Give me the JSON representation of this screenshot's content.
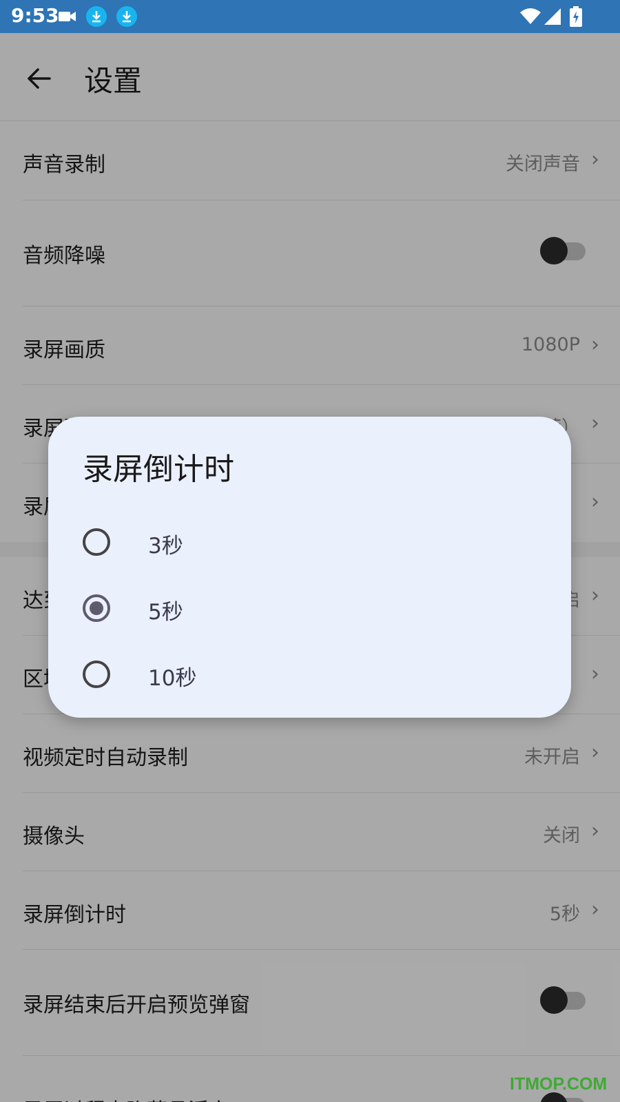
{
  "status_bar": {
    "time": "9:53",
    "icons": [
      "video-camera-icon",
      "download-icon",
      "download-icon",
      "wifi-icon",
      "signal-icon",
      "battery-charging-icon"
    ]
  },
  "header": {
    "title": "设置"
  },
  "settings": [
    {
      "label": "声音录制",
      "value": "关闭声音",
      "type": "chevron"
    },
    {
      "label": "音频降噪",
      "type": "toggle",
      "on": false
    },
    {
      "label": "录屏画质",
      "value": "1080P",
      "type": "chevron"
    },
    {
      "label": "录屏预...",
      "value": "...（推荐）",
      "type": "chevron"
    },
    {
      "label": "录屏...",
      "value": "",
      "type": "chevron"
    },
    {
      "label": "达到...",
      "value": "...启",
      "type": "chevron"
    },
    {
      "label": "区域...",
      "value": "",
      "type": "chevron"
    },
    {
      "label": "视频定时自动录制",
      "value": "未开启",
      "type": "chevron"
    },
    {
      "label": "摄像头",
      "value": "关闭",
      "type": "chevron"
    },
    {
      "label": "录屏倒计时",
      "value": "5秒",
      "type": "chevron"
    },
    {
      "label": "录屏结束后开启预览弹窗",
      "type": "toggle",
      "on": false
    },
    {
      "label": "录屏过程中隐藏悬浮窗",
      "type": "toggle",
      "on": false
    }
  ],
  "dialog": {
    "title": "录屏倒计时",
    "options": [
      {
        "label": "3秒",
        "selected": false
      },
      {
        "label": "5秒",
        "selected": true
      },
      {
        "label": "10秒",
        "selected": false
      }
    ]
  },
  "watermark": "ITMOP.COM",
  "colors": {
    "status_bar": "#2f74b5",
    "dialog_bg": "#ebf0fd",
    "radio_selected": "#5f5a6e",
    "download_badge": "#19b4f0",
    "watermark": "#3fa935"
  }
}
